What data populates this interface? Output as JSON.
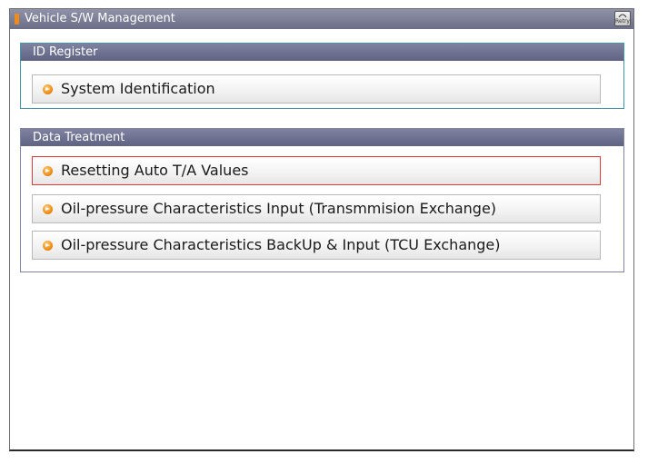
{
  "window": {
    "title": "Vehicle S/W Management",
    "retry_label": "Retry"
  },
  "groups": [
    {
      "header": "ID Register",
      "items": [
        {
          "label": "System Identification",
          "selected": false
        }
      ]
    },
    {
      "header": "Data Treatment",
      "items": [
        {
          "label": "Resetting Auto T/A Values",
          "selected": true
        },
        {
          "label": "Oil-pressure Characteristics Input (Transmmision Exchange)",
          "selected": false
        },
        {
          "label": "Oil-pressure Characteristics BackUp & Input (TCU Exchange)",
          "selected": false
        }
      ]
    }
  ],
  "colors": {
    "titlebar": "#7a7d96",
    "group_header": "#6f7292",
    "register_border": "#3f98a8",
    "selected_border": "#e23a3a",
    "bullet": "#f08c14"
  },
  "icons": {
    "title": "app-flag-icon",
    "retry": "retry-icon",
    "item_bullet": "orange-arrow-bullet-icon"
  }
}
